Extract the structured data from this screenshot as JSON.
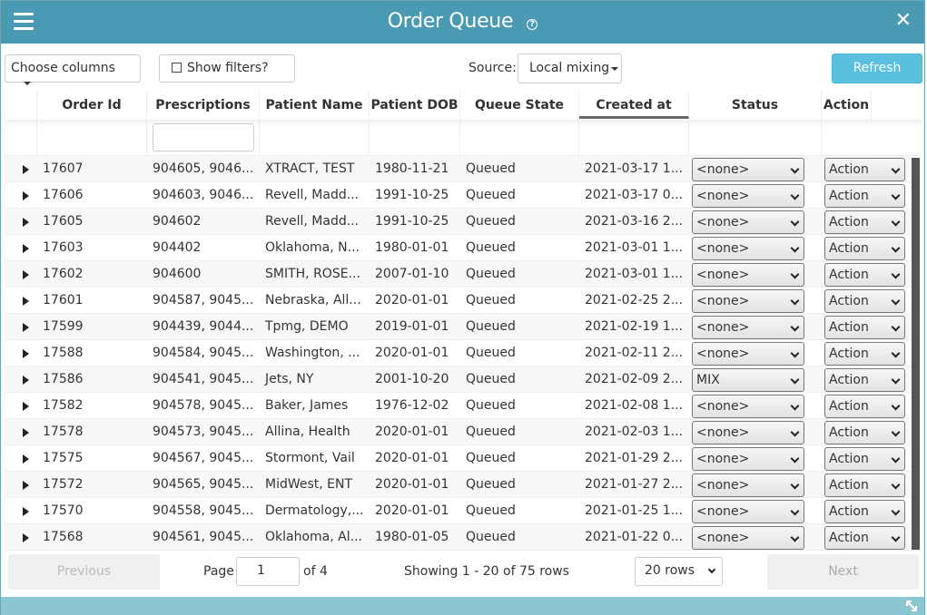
{
  "window": {
    "title": "Order Queue"
  },
  "toolbar": {
    "choose_columns": "Choose columns",
    "show_filters": "Show filters?",
    "source_label": "Source:",
    "source_value": "Local mixing",
    "refresh": "Refresh"
  },
  "columns": [
    "Order Id",
    "Prescriptions",
    "Patient Name",
    "Patient DOB",
    "Queue State",
    "Created at",
    "Status",
    "Action"
  ],
  "rows": [
    {
      "id": "17607",
      "rx": "904605, 9046...",
      "name": "XTRACT, TEST",
      "dob": "1980-11-21",
      "state": "Queued",
      "created": "2021-03-17 1...",
      "status": "<none>",
      "action": "Action"
    },
    {
      "id": "17606",
      "rx": "904603, 9046...",
      "name": "Revell, Madd...",
      "dob": "1991-10-25",
      "state": "Queued",
      "created": "2021-03-17 0...",
      "status": "<none>",
      "action": "Action"
    },
    {
      "id": "17605",
      "rx": "904602",
      "name": "Revell, Madd...",
      "dob": "1991-10-25",
      "state": "Queued",
      "created": "2021-03-16 2...",
      "status": "<none>",
      "action": "Action"
    },
    {
      "id": "17603",
      "rx": "904402",
      "name": "Oklahoma, N...",
      "dob": "1980-01-01",
      "state": "Queued",
      "created": "2021-03-01 1...",
      "status": "<none>",
      "action": "Action"
    },
    {
      "id": "17602",
      "rx": "904600",
      "name": "SMITH, ROSE...",
      "dob": "2007-01-10",
      "state": "Queued",
      "created": "2021-03-01 1...",
      "status": "<none>",
      "action": "Action"
    },
    {
      "id": "17601",
      "rx": "904587, 9045...",
      "name": "Nebraska, All...",
      "dob": "2020-01-01",
      "state": "Queued",
      "created": "2021-02-25 2...",
      "status": "<none>",
      "action": "Action"
    },
    {
      "id": "17599",
      "rx": "904439, 9044...",
      "name": "Tpmg, DEMO",
      "dob": "2019-01-01",
      "state": "Queued",
      "created": "2021-02-19 1...",
      "status": "<none>",
      "action": "Action"
    },
    {
      "id": "17588",
      "rx": "904584, 9045...",
      "name": "Washington, ...",
      "dob": "2020-01-01",
      "state": "Queued",
      "created": "2021-02-11 2...",
      "status": "<none>",
      "action": "Action"
    },
    {
      "id": "17586",
      "rx": "904541, 9045...",
      "name": "Jets, NY",
      "dob": "2001-10-20",
      "state": "Queued",
      "created": "2021-02-09 2...",
      "status": "MIX",
      "action": "Action"
    },
    {
      "id": "17582",
      "rx": "904578, 9045...",
      "name": "Baker, James",
      "dob": "1976-12-02",
      "state": "Queued",
      "created": "2021-02-08 1...",
      "status": "<none>",
      "action": "Action"
    },
    {
      "id": "17578",
      "rx": "904573, 9045...",
      "name": "Allina, Health",
      "dob": "2020-01-01",
      "state": "Queued",
      "created": "2021-02-03 1...",
      "status": "<none>",
      "action": "Action"
    },
    {
      "id": "17575",
      "rx": "904567, 9045...",
      "name": "Stormont, Vail",
      "dob": "2020-01-01",
      "state": "Queued",
      "created": "2021-01-29 2...",
      "status": "<none>",
      "action": "Action"
    },
    {
      "id": "17572",
      "rx": "904565, 9045...",
      "name": "MidWest, ENT",
      "dob": "2020-01-01",
      "state": "Queued",
      "created": "2021-01-27 2...",
      "status": "<none>",
      "action": "Action"
    },
    {
      "id": "17570",
      "rx": "904558, 9045...",
      "name": "Dermatology,...",
      "dob": "2020-01-01",
      "state": "Queued",
      "created": "2021-01-25 1...",
      "status": "<none>",
      "action": "Action"
    },
    {
      "id": "17568",
      "rx": "904561, 9045...",
      "name": "Oklahoma, Al...",
      "dob": "1980-01-05",
      "state": "Queued",
      "created": "2021-01-22 0...",
      "status": "<none>",
      "action": "Action"
    }
  ],
  "pagination": {
    "previous": "Previous",
    "page_label": "Page",
    "page_value": "1",
    "of_label": "of 4",
    "showing": "Showing 1 - 20 of 75 rows",
    "rows_per_page": "20 rows",
    "next": "Next"
  },
  "colors": {
    "titlebar": "#4a9ab3",
    "refresh": "#5bc0de",
    "bottombar": "#8cc6d2"
  }
}
